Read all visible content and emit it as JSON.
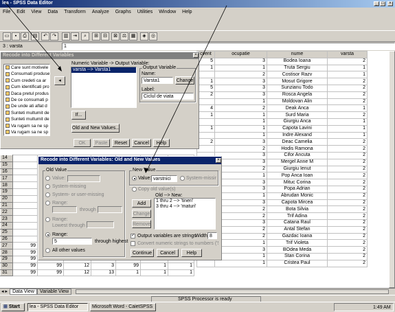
{
  "app": {
    "title": "lea - SPSS Data Editor"
  },
  "menu": [
    "File",
    "Edit",
    "View",
    "Data",
    "Transform",
    "Analyze",
    "Graphs",
    "Utilities",
    "Window",
    "Help"
  ],
  "cell_editor": {
    "ref": "3 : varsta",
    "value": "1"
  },
  "grid": {
    "headers": [
      "cvent",
      "ocupatie",
      "nume",
      "varsta"
    ],
    "rows": [
      {
        "c1": "5",
        "c2": "3",
        "nume": "Bodea Ioana",
        "v": "2"
      },
      {
        "c1": "1",
        "c2": "1",
        "nume": "Truta Sergiu",
        "v": "1"
      },
      {
        "c1": "",
        "c2": "2",
        "nume": "Costisor Razv",
        "v": "1"
      },
      {
        "c1": "1",
        "c2": "3",
        "nume": "Mosut Grigore",
        "v": "2"
      },
      {
        "c1": "5",
        "c2": "3",
        "nume": "Sunzianu Todo",
        "v": "2"
      },
      {
        "c1": "2",
        "c2": "3",
        "nume": "Rosca Angela",
        "v": "2"
      },
      {
        "c1": "",
        "c2": "1",
        "nume": "Moldovan Alin",
        "v": "2"
      },
      {
        "c1": "4",
        "c2": "2",
        "nume": "Deak Anca",
        "v": "1"
      },
      {
        "c1": "1",
        "c2": "1",
        "nume": "Surd Maria",
        "v": "2"
      },
      {
        "c1": "",
        "c2": "1",
        "nume": "Giurgiu Anca",
        "v": "1"
      },
      {
        "c1": "1",
        "c2": "1",
        "nume": "Capota Lavini",
        "v": "1"
      },
      {
        "c1": "",
        "c2": "1",
        "nume": "Indre Alexand",
        "v": "1"
      },
      {
        "c1": "2",
        "c2": "3",
        "nume": "Deac Camelia",
        "v": "2"
      },
      {
        "c1": "",
        "c2": "2",
        "nume": "Hodis Ramona",
        "v": "2"
      },
      {
        "c1": "",
        "c2": "3",
        "nume": "Cifor Ancuta",
        "v": "2"
      },
      {
        "c1": "",
        "c2": "3",
        "nume": "Mergel Anne M",
        "v": "2"
      },
      {
        "c1": "",
        "c2": "2",
        "nume": "Giurgiu Ienut",
        "v": "2"
      },
      {
        "c1": "",
        "c2": "1",
        "nume": "Pop Anca Ioan",
        "v": "2"
      },
      {
        "c1": "",
        "c2": "3",
        "nume": "Mituc Corina",
        "v": "2"
      },
      {
        "c1": "",
        "c2": "3",
        "nume": "Popa Adrian",
        "v": "2"
      },
      {
        "c1": "",
        "c2": "1",
        "nume": "Abrudan Monic",
        "v": "2"
      },
      {
        "c1": "",
        "c2": "3",
        "nume": "Capota Mircea",
        "v": "2"
      },
      {
        "c1": "",
        "c2": "2",
        "nume": "Bota Silvia",
        "v": "2"
      },
      {
        "c1": "",
        "c2": "2",
        "nume": "Trif Adina",
        "v": "2"
      },
      {
        "c1": "",
        "c2": "3",
        "nume": "Catana Raul",
        "v": "2"
      },
      {
        "c1": "",
        "c2": "2",
        "nume": "Antal Stefan",
        "v": "2"
      },
      {
        "c1": "",
        "c2": "2",
        "nume": "Gazdac Ioana",
        "v": "2"
      },
      {
        "c1": "",
        "c2": "1",
        "nume": "Trif Violeta",
        "v": "2"
      },
      {
        "c1": "",
        "c2": "3",
        "nume": "BOdea Meda",
        "v": "2"
      },
      {
        "c1": "",
        "c2": "1",
        "nume": "Stan Corina",
        "v": "2"
      },
      {
        "c1": "",
        "c2": "1",
        "nume": "Cristea Paul",
        "v": "2"
      }
    ],
    "left_rows": [
      {
        "n": "14"
      },
      {
        "n": "15"
      },
      {
        "n": "16"
      },
      {
        "n": "17"
      },
      {
        "n": "18"
      },
      {
        "n": "19"
      },
      {
        "n": "20"
      },
      {
        "n": "21"
      },
      {
        "n": "22"
      },
      {
        "n": "23"
      },
      {
        "n": "24"
      },
      {
        "n": "25"
      },
      {
        "n": "26"
      },
      {
        "n": "27",
        "a": "99",
        "b": "99",
        "c": "12",
        "d": "3",
        "e": "",
        "f": "",
        "g": "1"
      },
      {
        "n": "28",
        "a": "99",
        "b": "99",
        "c": "12",
        "d": "3",
        "e": "2",
        "f": "1",
        "g": "6"
      },
      {
        "n": "29",
        "a": "99",
        "b": "99",
        "c": "1",
        "d": "3",
        "e": "",
        "f": "",
        "g": "3"
      },
      {
        "n": "30",
        "a": "99",
        "b": "99",
        "c": "12",
        "d": "3",
        "e": "99",
        "f": "1",
        "g": "1"
      },
      {
        "n": "31",
        "a": "99",
        "b": "99",
        "c": "12",
        "d": "13",
        "e": "1",
        "f": "1",
        "g": "1"
      }
    ]
  },
  "tabs": {
    "data_view": "Data View",
    "variable_view": "Variable View"
  },
  "status": "SPSS Processor  is ready",
  "recode_dialog": {
    "title": "Recode into Different Variables",
    "variables": [
      "Care sunt motivele",
      "Consumati produse",
      "Cum credeti ca ar",
      "Cum identificati pro",
      "Daca pretul produs",
      "De ce consumati p",
      "De unde ati aflat d",
      "Sunteti multumit de",
      "Sunteti multumit de",
      "Va rugam sa ne sp",
      "Va rugam sa ne sp"
    ],
    "mapping_label": "Numeric Variable -> Output Variable:",
    "mapping_value": "varsta --> Varsta1",
    "output_group": "Output Variable",
    "name_label": "Name:",
    "name_value": "Varsta1",
    "change_button": "Change",
    "label_label": "Label:",
    "label_value": "Ciclul de viata",
    "if_button": "If...",
    "old_new_button": "Old and New Values...",
    "ok": "OK",
    "paste": "Paste",
    "reset": "Reset",
    "cancel": "Cancel",
    "help": "Help"
  },
  "old_new_dialog": {
    "title": "Recode into Different Variables: Old and New Values",
    "old_group": "Old Value",
    "opt_value": "Value:",
    "opt_system_missing": "System-missing",
    "opt_sys_or_user": "System- or user-missing",
    "opt_range": "Range:",
    "through": "through",
    "opt_range_lowest": "Range:",
    "lowest_through": "Lowest through",
    "opt_range_highest": "Range:",
    "range_highest_value": "5",
    "through_highest": "through highest",
    "opt_all_other": "All other values",
    "new_group": "New Value",
    "new_value_label": "Value:",
    "new_value": "varstnici",
    "new_system_missing": "System-missing",
    "copy_old": "Copy old value(s)",
    "old_new_list_label": "Old --> New:",
    "old_new_items": [
      "1 thru 2 --> 'tineri'",
      "3 thru 4 --> 'maturi'"
    ],
    "add": "Add",
    "change": "Change",
    "remove": "Remove",
    "output_strings": "Output variables are strings",
    "width_label": "Width:",
    "width_value": "8",
    "convert_numeric": "Convert numeric strings to numbers ('5'->5)",
    "continue": "Continue",
    "cancel": "Cancel",
    "help": "Help"
  },
  "taskbar": {
    "start": "Start",
    "task1": "lea - SPSS Data Editor",
    "task2": "Microsoft Word - CaietSPSS",
    "clock": "1:49 AM"
  }
}
